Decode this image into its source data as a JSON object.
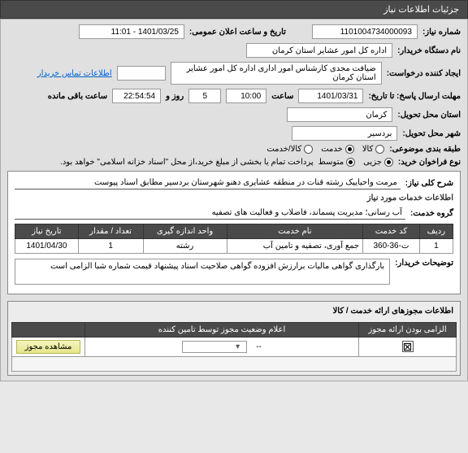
{
  "header": {
    "title": "جزئیات اطلاعات نیاز"
  },
  "info": {
    "need_no_label": "شماره نیاز:",
    "need_no": "1101004734000093",
    "announce_label": "تاریخ و ساعت اعلان عمومی:",
    "announce": "1401/03/25 - 11:01",
    "buyer_org_label": "نام دستگاه خریدار:",
    "buyer_org": "اداره کل امور عشایر استان کرمان",
    "requester_label": "ایجاد کننده درخواست:",
    "requester": "ضیافت مجدی کارشناس امور اداری اداره کل امور عشایر استان کرمان",
    "contact_link": "اطلاعات تماس خریدار",
    "deadline_label": "مهلت ارسال پاسخ: تا تاریخ:",
    "deadline_date": "1401/03/31",
    "time_label": "ساعت",
    "deadline_time": "10:00",
    "days": "5",
    "days_and_label": "روز و",
    "remaining_time": "22:54:54",
    "remaining_label": "ساعت باقی مانده",
    "province_label": "استان محل تحویل:",
    "province": "کرمان",
    "city_label": "شهر محل تحویل:",
    "city": "بردسیر",
    "subject_cat_label": "طبقه بندی موضوعی:",
    "cat_goods": "کالا",
    "cat_service": "خدمت",
    "cat_both": "کالا/خدمت",
    "funding_label": "نوع فراخوان خرید:",
    "fund_minor": "جزیی",
    "fund_medium": "متوسط",
    "fund_note": "پرداخت تمام یا بخشی از مبلغ خرید،از محل \"اسناد خزانه اسلامی\" خواهد بود."
  },
  "desc": {
    "title_label": "شرح کلی نیاز:",
    "title": "مرمت واحیاییک رشته قنات در منطقه عشایری دهنو شهرستان بردسیر مطابق اسناد پیوست",
    "services_label": "اطلاعات خدمات مورد نیاز",
    "group_label": "گروه خدمت:",
    "group": "آب رسانی؛ مدیریت پسماند، فاضلاب و فعالیت های تصفیه"
  },
  "table": {
    "cols": [
      "ردیف",
      "کد خدمت",
      "نام خدمت",
      "واحد اندازه گیری",
      "تعداد / مقدار",
      "تاریخ نیاز"
    ],
    "rows": [
      {
        "idx": "1",
        "code": "ت-36-360",
        "name": "جمع آوری، تصفیه و تامین آب",
        "unit": "رشته",
        "qty": "1",
        "date": "1401/04/30"
      }
    ]
  },
  "buyer_note": {
    "label": "توضیحات خریدار:",
    "text": "بارگذاری گواهی مالیات برارزش افزوده گواهی صلاحیت اسناد پیشنهاد قیمت شماره شبا الزامی است"
  },
  "permits": {
    "header": "اطلاعات مجوزهای ارائه خدمت / کالا",
    "cols": [
      "الزامی بودن ارائه مجوز",
      "اعلام وضعیت مجوز توسط تامین کننده",
      ""
    ],
    "view_btn": "مشاهده مجوز",
    "dash": "--"
  }
}
